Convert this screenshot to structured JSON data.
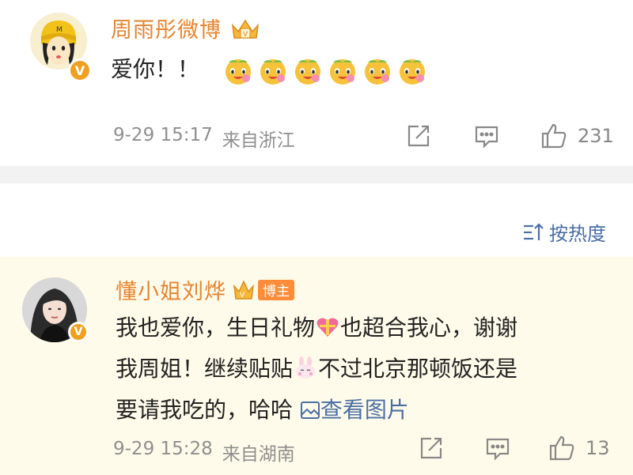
{
  "post": {
    "username": "周雨彤微博",
    "text": "爱你！！",
    "timestamp": "9-29 15:17",
    "source": "来自浙江",
    "like_count": "231",
    "emoji_count": 6
  },
  "sort": {
    "label": "按热度"
  },
  "reply": {
    "username": "懂小姐刘烨",
    "host_badge": "博主",
    "line1_a": "我也爱你，生日礼物",
    "line1_b": "也超合我心，谢谢",
    "line2_a": "我周姐！继续贴贴",
    "line2_b": "不过北京那顿饭还是",
    "line3_a": "要请我吃的，哈哈",
    "view_image": "查看图片",
    "timestamp": "9-29 15:28",
    "source": "来自湖南",
    "like_count": "13"
  },
  "colors": {
    "username": "#e8842f",
    "link": "#4a6fa5",
    "reply_bg": "#fffbea",
    "gap": "#f2f2f2"
  },
  "icons": [
    "share-icon",
    "comment-icon",
    "thumbs-up-icon",
    "sort-icon",
    "image-icon",
    "crown-icon",
    "verified-icon"
  ]
}
